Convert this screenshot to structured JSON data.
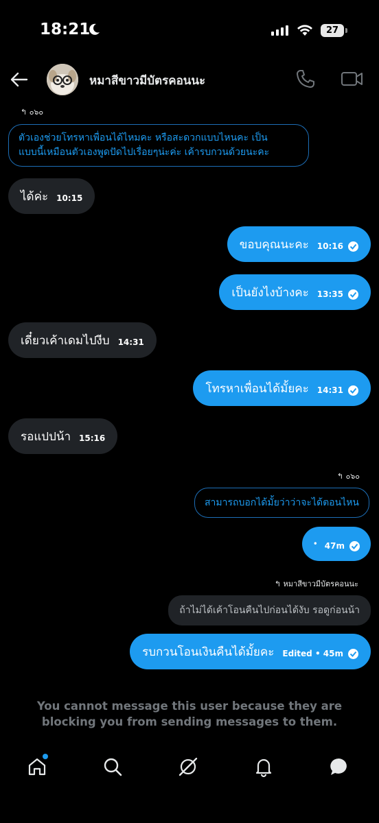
{
  "status_bar": {
    "time": "18:21",
    "battery": "27"
  },
  "header": {
    "contact_name": "หมาสีขาวมีบัตรคอนนะ"
  },
  "messages": [
    {
      "kind": "reply_ref",
      "text": "↰ ๐๖๐"
    },
    {
      "kind": "quote",
      "lines": [
        "ตัวเองช่วยโทรหาเพื่อนได้ไหมคะ หรือสะดวกแบบไหนคะ เป็น",
        "แบบนี้เหมือนตัวเองพูดปัดไปเรื่อยๆน่ะค่ะ เค้ารบกวนด้วยนะคะ"
      ]
    },
    {
      "kind": "in",
      "text": "ได้ค่ะ",
      "time": "10:15"
    },
    {
      "kind": "out",
      "text": "ขอบคุณนะคะ",
      "time": "10:16"
    },
    {
      "kind": "out",
      "text": "เป็นยังไงบ้างคะ",
      "time": "13:35"
    },
    {
      "kind": "in",
      "text": "เดี๋ยวเค้าเดมไปงีบ",
      "time": "14:31"
    },
    {
      "kind": "out",
      "text": "โทรหาเพื่อนได้มั้ยคะ",
      "time": "14:31"
    },
    {
      "kind": "in",
      "text": "รอแปปน้า",
      "time": "15:16"
    },
    {
      "kind": "reply_ref",
      "text": "↰ ๐๖๐"
    },
    {
      "kind": "quote",
      "text": "สามารถบอกได้มั้ยว่าว่าจะได้ตอนไหน"
    },
    {
      "kind": "out",
      "text": "•",
      "time": "47m"
    },
    {
      "kind": "reply_ref",
      "text": "↰ หมาสีขาวมีบัตรคอนนะ"
    },
    {
      "kind": "grey_quote",
      "text": "ถ้าไม่ได้เค้าโอนคืนไปก่อนได้งับ รอดูก่อนน้า"
    },
    {
      "kind": "out",
      "text": "รบกวนโอนเงินคืนได้มั้ยคะ",
      "time": "Edited • 45m"
    }
  ],
  "blocked_note": "You cannot message this user because they are blocking you from sending messages to them.",
  "colors": {
    "accent": "#1d9bf0",
    "incoming_bubble": "#202327",
    "background": "#000000",
    "muted_text": "#71767b"
  },
  "bottom_nav": [
    "home-icon",
    "search-icon",
    "grok-icon",
    "notifications-icon",
    "messages-icon"
  ]
}
